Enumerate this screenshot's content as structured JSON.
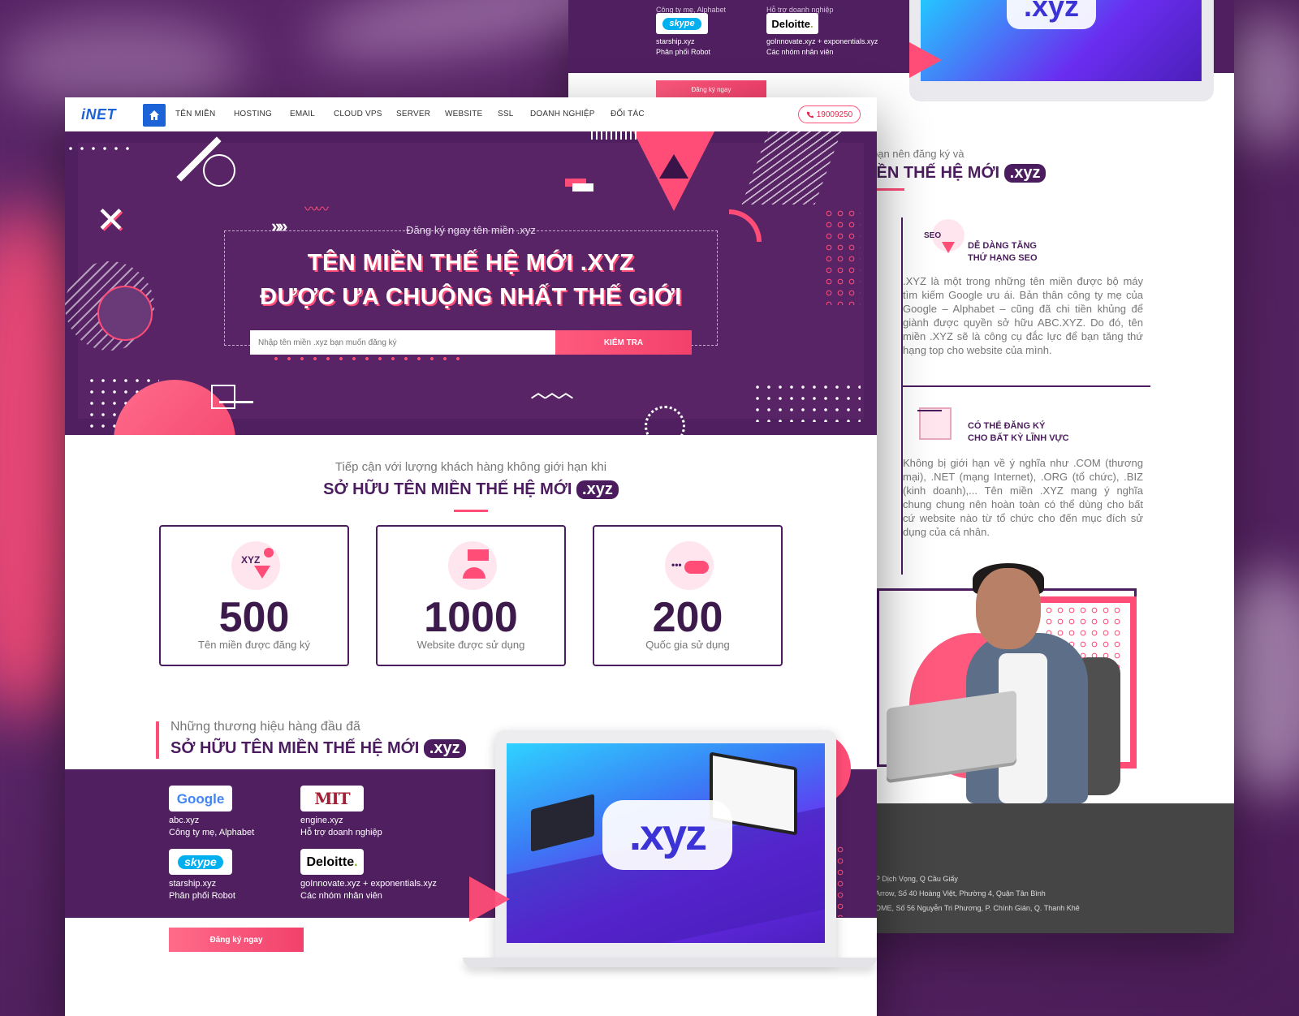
{
  "back": {
    "brands": [
      {
        "top_cut": "Công ty mẹ, Alphabet",
        "logo": "skype",
        "domain": "starship.xyz",
        "desc": "Phân phối Robot"
      },
      {
        "top_cut": "Hỗ trợ doanh nghiệp",
        "logo": "Deloitte",
        "domain": "goInnovate.xyz + exponentials.xyz",
        "desc": "Các nhóm nhân viên"
      }
    ],
    "cta": "Đăng ký ngay",
    "xyz": ".xyz",
    "heading_sub": "bạn nên đăng ký và",
    "heading": "IỀN THẾ HỆ MỚI",
    "heading_pill": ".xyz",
    "features": [
      {
        "icon_label": "SEO",
        "title_l1": "DỄ DÀNG TĂNG",
        "title_l2": "THỨ HẠNG SEO",
        "text": ".XYZ là một trong những tên miền được bộ máy tìm kiếm Google ưu ái. Bản thân công ty mẹ của Google – Alphabet – cũng đã chi tiền khủng để giành được quyền sở hữu ABC.XYZ. Do đó, tên miền .XYZ sẽ là công cụ đắc lực để bạn tăng thứ hạng top cho website của mình."
      },
      {
        "title_l1": "CÓ THỂ ĐĂNG KÝ",
        "title_l2": "CHO BẤT KỲ LĨNH VỰC",
        "text": "Không bị giới hạn về ý nghĩa như .COM (thương mại), .NET (mạng Internet), .ORG (tổ chức), .BIZ (kinh doanh),... Tên miền .XYZ mang ý nghĩa chung chung nên hoàn toàn có thể dùng cho bất cứ website nào từ tổ chức cho đến mục đích sử dụng của cá nhân."
      }
    ],
    "footer_lines": [
      "P Dịch Vọng, Q Cầu Giấy",
      "Arrow, Số 40 Hoàng Việt, Phường 4, Quận Tân Bình",
      "OME, Số 56 Nguyễn Tri Phương, P. Chính Gián, Q. Thanh Khê"
    ]
  },
  "nav": {
    "logo": "iNET",
    "home_icon": "home-icon",
    "items": [
      "TÊN MIỀN",
      "HOSTING",
      "EMAIL",
      "CLOUD VPS",
      "SERVER",
      "WEBSITE",
      "SSL",
      "DOANH NGHIỆP",
      "ĐỐI TÁC"
    ],
    "phone": "19009250",
    "phone_icon": "phone-icon"
  },
  "hero": {
    "sub": "Đăng ký ngay tên miền .xyz",
    "title_l1": "TÊN MIỀN THẾ HỆ MỚI .XYZ",
    "title_l2": "ĐƯỢC ƯA CHUỘNG NHẤT THẾ GIỚI",
    "search_placeholder": "Nhập tên miền .xyz bạn muốn đăng ký",
    "search_button": "KIỂM TRA"
  },
  "stats": {
    "sub": "Tiếp cận với lượng khách hàng không giới hạn khi",
    "heading": "SỞ HỮU TÊN MIỀN THẾ HỆ MỚI",
    "heading_pill": ".xyz",
    "cards": [
      {
        "icon_text": "XYZ",
        "number": "500",
        "label": "Tên miền được đăng ký"
      },
      {
        "number": "1000",
        "label": "Website được sử dụng"
      },
      {
        "icon_text": "•••",
        "number": "200",
        "label": "Quốc gia sử dụng"
      }
    ]
  },
  "brands": {
    "sub": "Những thương hiệu hàng đầu đã",
    "heading": "SỞ HỮU TÊN MIỀN THẾ HỆ MỚI",
    "heading_pill": ".xyz",
    "items": [
      {
        "logo": "Google",
        "domain": "abc.xyz",
        "desc": "Công ty mẹ, Alphabet"
      },
      {
        "logo": "MIT",
        "domain": "engine.xyz",
        "desc": "Hỗ trợ doanh nghiệp"
      },
      {
        "logo": "skype",
        "domain": "starship.xyz",
        "desc": "Phân phối Robot"
      },
      {
        "logo": "Deloitte",
        "domain": "goInnovate.xyz + exponentials.xyz",
        "desc": "Các nhóm nhân viên"
      }
    ],
    "cta": "Đăng ký ngay",
    "screen_text": ".xyz"
  },
  "colors": {
    "purple": "#4f1f5f",
    "pink": "#ff4d77",
    "blue": "#1d63d8"
  }
}
